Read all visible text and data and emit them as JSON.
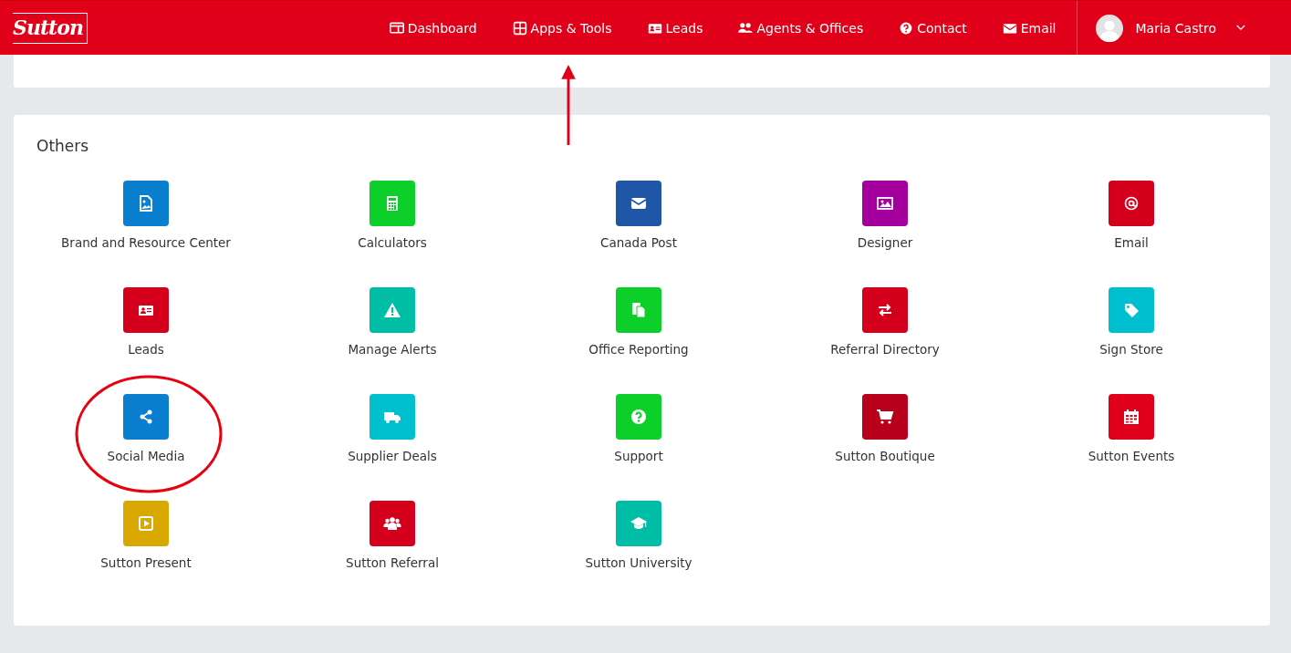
{
  "header": {
    "logo": "Sutton",
    "nav": [
      {
        "label": "Dashboard",
        "highlighted": false
      },
      {
        "label": "Apps & Tools",
        "highlighted": true
      },
      {
        "label": "Leads",
        "highlighted": false
      },
      {
        "label": "Agents & Offices",
        "highlighted": false
      },
      {
        "label": "Contact",
        "highlighted": false
      },
      {
        "label": "Email",
        "highlighted": false
      }
    ],
    "user": {
      "name": "Maria Castro"
    }
  },
  "section": {
    "title": "Others",
    "apps": [
      {
        "label": "Brand and Resource Center",
        "color": "#0a7fd0",
        "highlighted": false
      },
      {
        "label": "Calculators",
        "color": "#0ccf2a",
        "highlighted": false
      },
      {
        "label": "Canada Post",
        "color": "#1f56a5",
        "highlighted": false
      },
      {
        "label": "Designer",
        "color": "#a4009e",
        "highlighted": false
      },
      {
        "label": "Email",
        "color": "#d4001c",
        "highlighted": false
      },
      {
        "label": "Leads",
        "color": "#d4001c",
        "highlighted": false
      },
      {
        "label": "Manage Alerts",
        "color": "#00bea6",
        "highlighted": false
      },
      {
        "label": "Office Reporting",
        "color": "#0ccf2a",
        "highlighted": false
      },
      {
        "label": "Referral Directory",
        "color": "#d4001c",
        "highlighted": false
      },
      {
        "label": "Sign Store",
        "color": "#00c0d0",
        "highlighted": false
      },
      {
        "label": "Social Media",
        "color": "#0a7fd0",
        "highlighted": true
      },
      {
        "label": "Supplier Deals",
        "color": "#00c0d0",
        "highlighted": false
      },
      {
        "label": "Support",
        "color": "#0ccf2a",
        "highlighted": false
      },
      {
        "label": "Sutton Boutique",
        "color": "#b8001a",
        "highlighted": false
      },
      {
        "label": "Sutton Events",
        "color": "#e0001a",
        "highlighted": false
      },
      {
        "label": "Sutton Present",
        "color": "#d8a800",
        "highlighted": false
      },
      {
        "label": "Sutton Referral",
        "color": "#d4001c",
        "highlighted": false
      },
      {
        "label": "Sutton University",
        "color": "#00bea6",
        "highlighted": false
      }
    ]
  }
}
